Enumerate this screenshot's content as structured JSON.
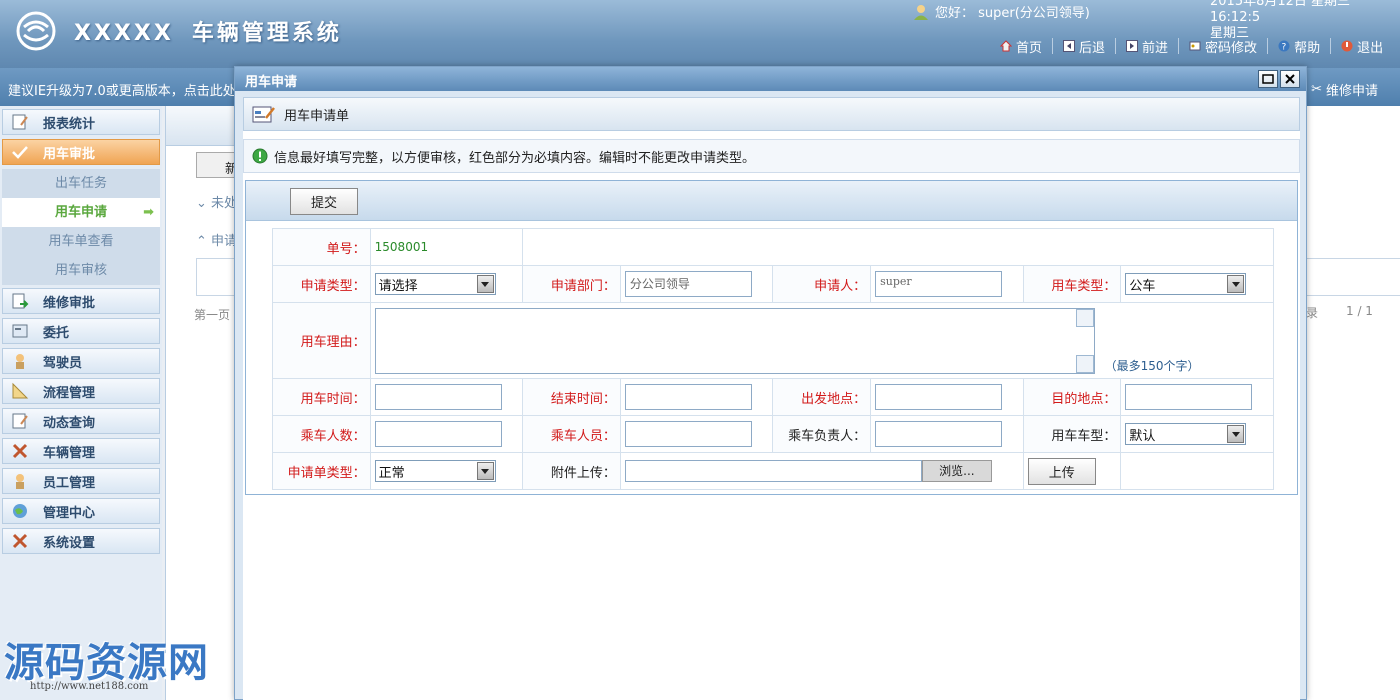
{
  "header": {
    "brand": "XXXXX",
    "title": "车辆管理系统",
    "greeting": "您好： super(分公司领导)",
    "date_line1": "2015年8月12日 星期三  16:12:5",
    "date_line2": "星期三",
    "nav": [
      {
        "label": "首页",
        "icon": "home-icon"
      },
      {
        "label": "后退",
        "icon": "back-icon"
      },
      {
        "label": "前进",
        "icon": "forward-icon"
      },
      {
        "label": "密码修改",
        "icon": "key-icon"
      },
      {
        "label": "帮助",
        "icon": "help-icon"
      },
      {
        "label": "退出",
        "icon": "exit-icon"
      }
    ]
  },
  "notice": {
    "text": "建议IE升级为7.0或更高版本，点击此处",
    "right_link": "维修申请"
  },
  "sidebar": {
    "items": [
      {
        "label": "报表统计"
      },
      {
        "label": "用车审批"
      },
      {
        "label": "维修审批"
      },
      {
        "label": "委托"
      },
      {
        "label": "驾驶员"
      },
      {
        "label": "流程管理"
      },
      {
        "label": "动态查询"
      },
      {
        "label": "车辆管理"
      },
      {
        "label": "员工管理"
      },
      {
        "label": "管理中心"
      },
      {
        "label": "系统设置"
      }
    ],
    "sub_items": [
      {
        "label": "出车任务"
      },
      {
        "label": "用车申请"
      },
      {
        "label": "用车单查看"
      },
      {
        "label": "用车审核"
      }
    ]
  },
  "background_page": {
    "new_btn": "新",
    "section1": "未处",
    "section2": "申请",
    "first_page": "第一页",
    "records": "录",
    "pages": "1 / 1"
  },
  "dialog": {
    "title": "用车申请",
    "form_title": "用车申请单",
    "info": "信息最好填写完整，以方便审核，红色部分为必填内容。编辑时不能更改申请类型。",
    "submit": "提交",
    "fields": {
      "order_no_label": "单号：",
      "order_no_value": "1508001",
      "apply_type_label": "申请类型：",
      "apply_type_value": "请选择",
      "dept_label": "申请部门：",
      "dept_value": "分公司领导",
      "applicant_label": "申请人：",
      "applicant_value": "super",
      "car_type_label": "用车类型：",
      "car_type_value": "公车",
      "reason_label": "用车理由：",
      "reason_hint": "（最多150个字）",
      "use_time_label": "用车时间：",
      "end_time_label": "结束时间：",
      "depart_label": "出发地点：",
      "dest_label": "目的地点：",
      "passenger_count_label": "乘车人数：",
      "passengers_label": "乘车人员：",
      "leader_label": "乘车负责人：",
      "car_model_label": "用车车型：",
      "car_model_value": "默认",
      "order_type_label": "申请单类型：",
      "order_type_value": "正常",
      "attach_label": "附件上传：",
      "browse": "浏览...",
      "upload": "上传"
    }
  },
  "watermark": {
    "text": "源码资源网",
    "url": "http://www.net188.com"
  },
  "colors": {
    "header": "#6f97bd",
    "required_label": "#d21a1a",
    "active_menu": "#f0a453",
    "current_sub": "#5aa83e"
  }
}
